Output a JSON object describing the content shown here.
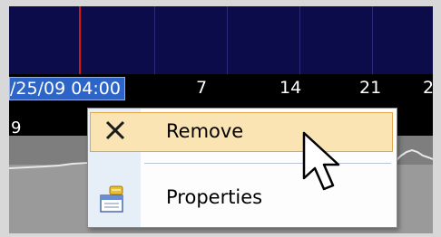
{
  "axis": {
    "date_label": "/25/09 04:00",
    "ticks": [
      "7",
      "14",
      "21",
      "2"
    ],
    "row2_label": "9"
  },
  "context_menu": {
    "items": [
      {
        "label": "Remove",
        "icon": "close-icon",
        "highlighted": true
      },
      {
        "label": "Properties",
        "icon": "properties-icon",
        "highlighted": false
      }
    ]
  },
  "colors": {
    "plot_background": "#0c0c4a",
    "marker_line": "#d01818",
    "date_label_background": "#2c64c8",
    "highlight_background": "#fbe4b4",
    "highlight_border": "#e3a64a"
  },
  "cursor": {
    "icon": "arrow-cursor-icon"
  }
}
